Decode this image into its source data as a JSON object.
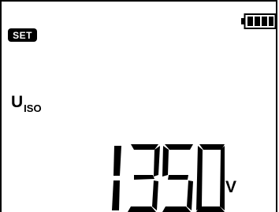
{
  "status": {
    "set_label": "SET"
  },
  "battery": {
    "level": 1.0
  },
  "parameter": {
    "symbol": "U",
    "subscript": "ISO"
  },
  "reading": {
    "value": "1350",
    "unit": "V"
  }
}
